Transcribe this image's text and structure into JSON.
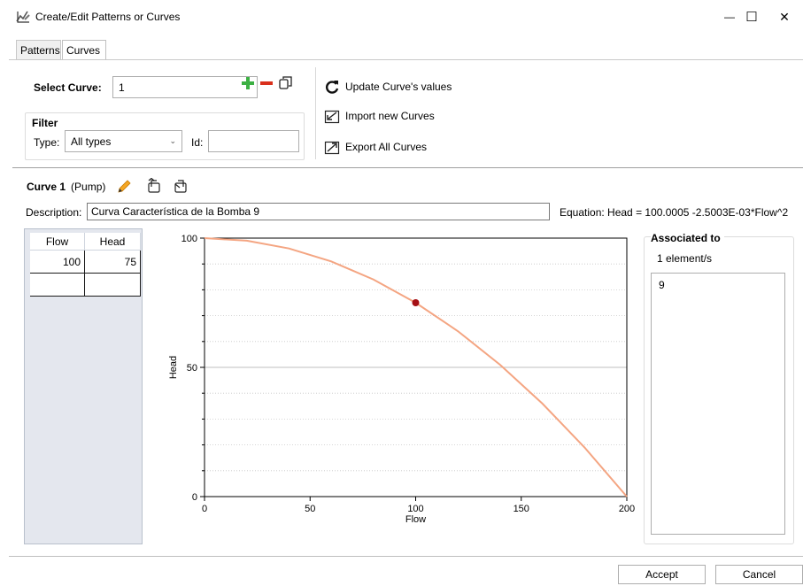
{
  "window": {
    "title": "Create/Edit Patterns or Curves",
    "minimize": "—",
    "maximize": "☐",
    "close": "✕"
  },
  "tabs": [
    {
      "label": "Patterns",
      "active": false
    },
    {
      "label": "Curves",
      "active": true
    }
  ],
  "select_curve": {
    "label": "Select Curve:",
    "value": "1"
  },
  "filter": {
    "title": "Filter",
    "type_label": "Type:",
    "type_value": "All types",
    "id_label": "Id:",
    "id_value": ""
  },
  "actions": {
    "update": "Update Curve's values",
    "import": "Import new Curves",
    "export": "Export All Curves"
  },
  "curve": {
    "name": "Curve 1",
    "kind": "(Pump)",
    "description_label": "Description:",
    "description": "Curva Característica de la Bomba 9",
    "equation": "Equation:  Head = 100.0005 -2.5003E-03*Flow^2"
  },
  "table": {
    "headers": [
      "Flow",
      "Head"
    ],
    "rows": [
      [
        "100",
        "75"
      ],
      [
        "",
        ""
      ]
    ]
  },
  "chart_data": {
    "type": "line",
    "xlabel": "Flow",
    "ylabel": "Head",
    "xlim": [
      0,
      200
    ],
    "ylim": [
      0,
      100
    ],
    "x_ticks": [
      "0",
      "50",
      "100",
      "150",
      "200"
    ],
    "y_ticks": [
      "0",
      "50",
      "100"
    ],
    "series": [
      {
        "x": [
          0,
          20,
          40,
          60,
          80,
          100,
          120,
          140,
          160,
          180,
          200
        ],
        "y": [
          100.0,
          99.0,
          96.0,
          91.0,
          84.0,
          75.0,
          64.0,
          51.0,
          36.0,
          19.0,
          0.0
        ],
        "color": "#f4a582"
      }
    ],
    "points": [
      {
        "x": 100,
        "y": 75,
        "color": "#a50f15"
      }
    ],
    "grid": true
  },
  "associated": {
    "title": "Associated to",
    "count": "1 element/s",
    "items": [
      "9"
    ]
  },
  "buttons": {
    "accept": "Accept",
    "cancel": "Cancel"
  }
}
